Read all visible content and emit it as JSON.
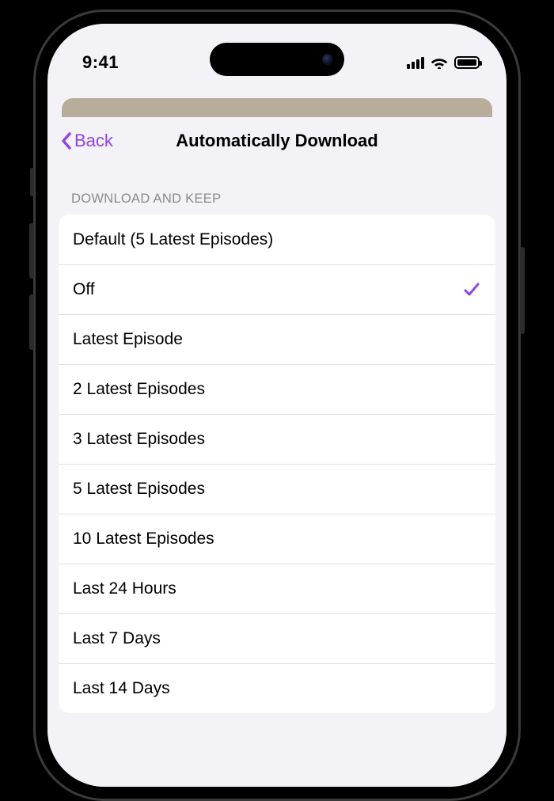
{
  "status": {
    "time": "9:41"
  },
  "nav": {
    "back_label": "Back",
    "title": "Automatically Download"
  },
  "section": {
    "header": "DOWNLOAD AND KEEP",
    "selected_index": 1,
    "options": [
      {
        "label": "Default (5 Latest Episodes)"
      },
      {
        "label": "Off"
      },
      {
        "label": "Latest Episode"
      },
      {
        "label": "2 Latest Episodes"
      },
      {
        "label": "3 Latest Episodes"
      },
      {
        "label": "5 Latest Episodes"
      },
      {
        "label": "10 Latest Episodes"
      },
      {
        "label": "Last 24 Hours"
      },
      {
        "label": "Last 7 Days"
      },
      {
        "label": "Last 14 Days"
      }
    ]
  },
  "colors": {
    "accent": "#8e44ec"
  }
}
